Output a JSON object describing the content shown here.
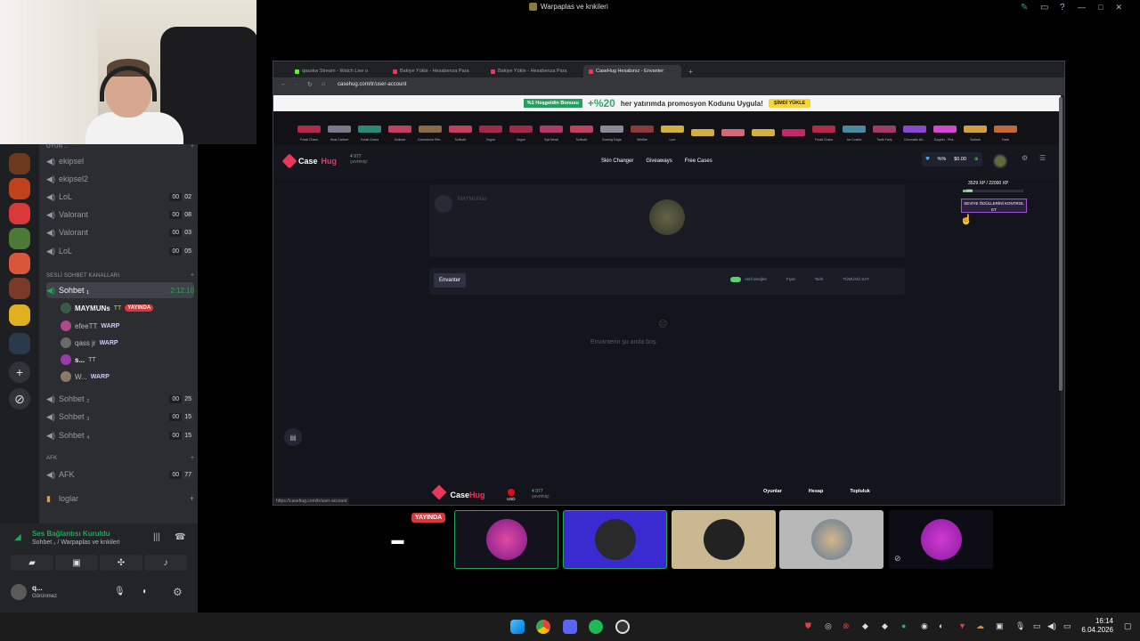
{
  "window": {
    "title": "Warpaplas ve knkileri"
  },
  "servers": {
    "home": "Sunucu Ekle",
    "explore": "Keşfet"
  },
  "channels": {
    "top_category": "OYUN ..",
    "text_channels": [
      {
        "name": "ekipsel"
      },
      {
        "name": "ekipsel2"
      },
      {
        "name": "LoL",
        "a": "00",
        "b": "02"
      },
      {
        "name": "Valorant",
        "a": "00",
        "b": "08"
      },
      {
        "name": "Valorant",
        "a": "00",
        "b": "03"
      },
      {
        "name": "LoL",
        "a": "00",
        "b": "05"
      }
    ],
    "voice_category": "SESLİ SOHBET KANALLARI",
    "active_channel": {
      "name": "Sohbet ₁",
      "time": "2:12:10"
    },
    "users": [
      {
        "name": "MAYMUNs",
        "tag": "TT",
        "live": "YAYINDA"
      },
      {
        "name": "efeeTT",
        "tag": "WARP"
      },
      {
        "name": "qass jr",
        "tag": "WARP"
      },
      {
        "name": "s...",
        "tag": "TT"
      },
      {
        "name": "W...",
        "tag": "WARP"
      }
    ],
    "other_voice": [
      {
        "name": "Sohbet ₂",
        "a": "00",
        "b": "25"
      },
      {
        "name": "Sohbet ₃",
        "a": "00",
        "b": "15"
      },
      {
        "name": "Sohbet ₄",
        "a": "00",
        "b": "15"
      }
    ],
    "afk_category": "AFK",
    "afk": {
      "name": "AFK",
      "a": "00",
      "b": "77"
    },
    "logs": "loglar"
  },
  "voice_panel": {
    "status": "Ses Bağlantısı Kuruldu",
    "subtitle": "Sohbet ₁ / Warpaplas ve knkileri",
    "username": "q...",
    "user_status": "Görünmez"
  },
  "browser": {
    "tabs": [
      {
        "label": "qasskw Stream - Watch Live o",
        "color": "#53fc18"
      },
      {
        "label": "Bakiye Yükle - Hesabenza Para",
        "color": "#e8385a"
      },
      {
        "label": "Bakiye Yükle - Hesabenza Para",
        "color": "#e8385a"
      },
      {
        "label": "CaseHug Hesabınız - Envanter",
        "color": "#e8385a"
      }
    ],
    "url": "casehug.com/tr/user-account",
    "status_url": "https://casehug.com/tr/user-account"
  },
  "promo": {
    "badge": "%1 Hoşgeldin Bonusu",
    "percent": "+%20",
    "text": "her yatırımda promosyon Kodunu Uygula!",
    "cta": "ŞİMDİ YÜKLE"
  },
  "drops": [
    "Fossil Chaos",
    "Heat Cabinet",
    "Fossil Chaos",
    "Solitude",
    "Gravestone Rev...",
    "Solitude",
    "Vogue",
    "Vogue",
    "Syd Mead",
    "Solitude",
    "Soaring Eagle",
    "Wildfire",
    "Lore",
    "",
    "",
    "",
    "",
    "Fossil Chaos",
    "Ice Coaled",
    "Tooth Fairy",
    "Chromatic Ab...",
    "Doppler - Pha...",
    "Solitare",
    "Fade"
  ],
  "site": {
    "brand_a": "Case",
    "brand_b": "Hug",
    "online_count": "4 977",
    "online_label": "çevrimiçi",
    "nav": [
      "Skin Changer",
      "Giveaways",
      "Free Cases"
    ],
    "wallet_pct": "%%",
    "balance": "$0.00",
    "xp": "3529 XP / 22000 XP",
    "xp_pct": "16%",
    "xp_fraction": 0.16,
    "xp_button": "SEVİYE ÖDÜLLERİNİ KONTROL ET",
    "profile_name": "MAYMUNas",
    "inventory_tab": "Envanter",
    "toggle_label": "Aktif deeğler",
    "filter1": "Fiyat",
    "filter2": "Tarih",
    "sell_all": "TÜMÜNÜ SAT",
    "empty": "Envanterin şu anda boş.",
    "footer_brand_a": "Case",
    "footer_brand_b": "Hug",
    "footer_online": "4 977",
    "footer_online_label": "çevrimiçi",
    "footer_currency": "USD",
    "footer_links": [
      "Oyunlar",
      "Hesap",
      "Topluluk"
    ]
  },
  "participants": {
    "live": "YAYINDA"
  },
  "taskbar": {
    "time": "16:14",
    "date": "6.04.2026"
  }
}
